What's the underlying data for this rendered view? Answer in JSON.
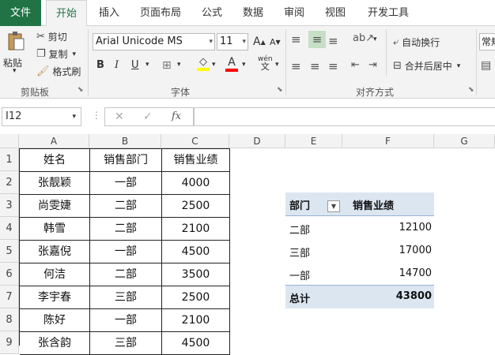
{
  "tabs": [
    "文件",
    "开始",
    "插入",
    "页面布局",
    "公式",
    "数据",
    "审阅",
    "视图",
    "开发工具"
  ],
  "clipboard": {
    "paste": "粘贴",
    "cut": "剪切",
    "copy": "复制",
    "format_painter": "格式刷",
    "label": "剪贴板"
  },
  "font": {
    "name": "Arial Unicode MS",
    "size": "11",
    "bold": "B",
    "italic": "I",
    "underline": "U",
    "label": "字体",
    "phonetic": "wén"
  },
  "alignment": {
    "wrap": "自动换行",
    "merge": "合并后居中",
    "label": "对齐方式"
  },
  "number": {
    "format": "常规"
  },
  "formula_bar": {
    "name_box": "I12",
    "cancel": "✕",
    "enter": "✓",
    "fx": "fx",
    "formula": ""
  },
  "columns": [
    "A",
    "B",
    "C",
    "D",
    "E",
    "F",
    "G"
  ],
  "rows": [
    "1",
    "2",
    "3",
    "4",
    "5",
    "6",
    "7",
    "8",
    "9"
  ],
  "table": {
    "headers": [
      "姓名",
      "销售部门",
      "销售业绩"
    ],
    "rows": [
      [
        "张靓颖",
        "一部",
        "4000"
      ],
      [
        "尚雯婕",
        "二部",
        "2500"
      ],
      [
        "韩雪",
        "二部",
        "2100"
      ],
      [
        "张嘉倪",
        "一部",
        "4500"
      ],
      [
        "何洁",
        "二部",
        "3500"
      ],
      [
        "李宇春",
        "三部",
        "2500"
      ],
      [
        "陈好",
        "一部",
        "2100"
      ],
      [
        "张含韵",
        "三部",
        "4500"
      ]
    ]
  },
  "pivot": {
    "header_dept": "部门",
    "header_sales": "销售业绩",
    "rows": [
      [
        "二部",
        "12100"
      ],
      [
        "三部",
        "17000"
      ],
      [
        "一部",
        "14700"
      ]
    ],
    "total_label": "总计",
    "total_value": "43800"
  },
  "colors": {
    "excel_green": "#217346",
    "pivot_header": "#dce6f1",
    "pivot_total": "#dce6f1"
  }
}
